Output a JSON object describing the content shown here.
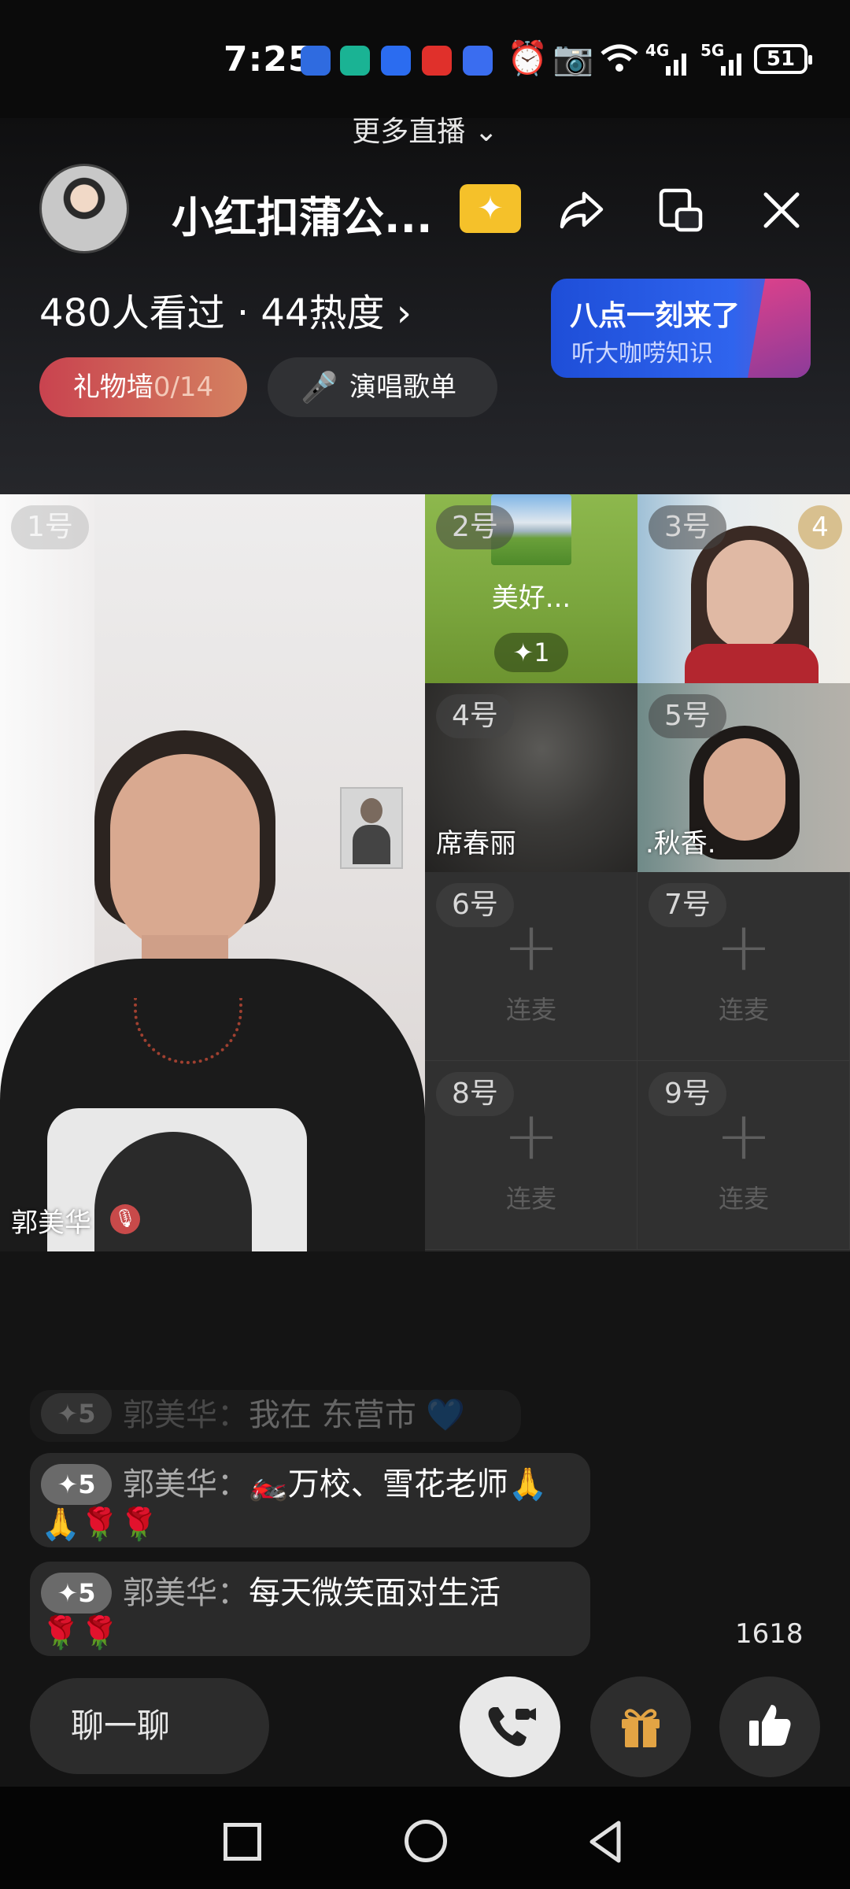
{
  "status_bar": {
    "time": "7:25",
    "network_4g": "4G",
    "network_5g": "5G",
    "battery": "51"
  },
  "header": {
    "more_live": "更多直播 ⌄",
    "room_title": "小红扣蒲公...",
    "stats": "480人看过 · 44热度 ›",
    "promo_line1": "八点一刻来了",
    "promo_line2": "听大咖唠知识",
    "gift_wall_label": "礼物墙",
    "gift_wall_count": "0/14",
    "song_list_label": "演唱歌单",
    "accent_color": "#f5c12a"
  },
  "seats": {
    "seat1": {
      "num": "1号",
      "name": "郭美华"
    },
    "seat2": {
      "num": "2号",
      "name": "美好...",
      "likes": "✦1"
    },
    "seat3": {
      "num": "3号",
      "count": "4"
    },
    "seat4": {
      "num": "4号",
      "name": "席春丽"
    },
    "seat5": {
      "num": "5号",
      "name": ".秋香."
    },
    "seat6": {
      "num": "6号",
      "action": "连麦"
    },
    "seat7": {
      "num": "7号",
      "action": "连麦"
    },
    "seat8": {
      "num": "8号",
      "action": "连麦"
    },
    "seat9": {
      "num": "9号",
      "action": "连麦"
    }
  },
  "chat": {
    "messages": [
      {
        "level": "✦5",
        "user": "郭美华：",
        "text": "我在 东营市 💙"
      },
      {
        "level": "✦5",
        "user": "郭美华：",
        "text": "🏍️万校、雪花老师🙏",
        "text2": "🙏🌹🌹"
      },
      {
        "level": "✦5",
        "user": "郭美华：",
        "text": "每天微笑面对生活",
        "text2": "🌹🌹"
      }
    ]
  },
  "like_count": "1618",
  "bottom_bar": {
    "chat_placeholder": "聊一聊"
  },
  "icons": {
    "share": "share-icon",
    "float_window": "float-window-icon",
    "close": "close-icon",
    "call": "video-call-icon",
    "gift": "gift-icon",
    "like": "thumbs-up-icon"
  }
}
